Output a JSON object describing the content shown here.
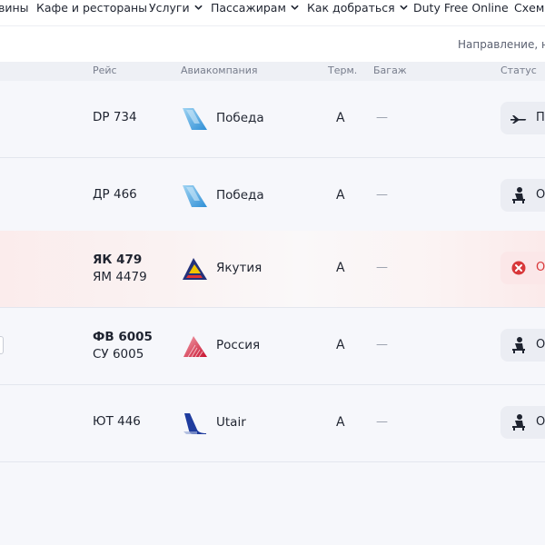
{
  "nav": {
    "items": [
      {
        "label": "вины",
        "has_dropdown": false
      },
      {
        "label": "Кафе и рестораны",
        "has_dropdown": false
      },
      {
        "label": "Услуги",
        "has_dropdown": true
      },
      {
        "label": "Пассажирам",
        "has_dropdown": true
      },
      {
        "label": "Как добраться",
        "has_dropdown": true
      },
      {
        "label": "Duty Free Online",
        "has_dropdown": false
      },
      {
        "label": "Схема",
        "has_dropdown": false
      }
    ]
  },
  "direction": {
    "label": "Направление, но"
  },
  "table": {
    "headers": {
      "flight": "Рейс",
      "airline": "Авиакомпания",
      "terminal": "Терм.",
      "baggage": "Багаж",
      "status": "Статус"
    },
    "rows": [
      {
        "flights": [
          "DP 734"
        ],
        "airline": "Победа",
        "logo": "pobeda-logo-icon",
        "terminal": "A",
        "baggage": "—",
        "status_icon": "airplane-icon",
        "status_text": "П",
        "cancelled": false
      },
      {
        "flights": [
          "ДР 466"
        ],
        "airline": "Победа",
        "logo": "pobeda-logo-icon",
        "terminal": "A",
        "baggage": "—",
        "status_icon": "waiting-passenger-icon",
        "status_text": "О",
        "cancelled": false
      },
      {
        "flights": [
          "ЯК 479",
          "ЯМ 4479"
        ],
        "airline": "Якутия",
        "logo": "yakutia-logo-icon",
        "terminal": "A",
        "baggage": "—",
        "status_icon": "cancel-x-icon",
        "status_text": "О",
        "cancelled": true
      },
      {
        "flights": [
          "ФВ 6005",
          "СУ 6005"
        ],
        "airline": "Россия",
        "logo": "rossiya-logo-icon",
        "terminal": "A",
        "baggage": "—",
        "status_icon": "waiting-passenger-icon",
        "status_text": "О",
        "cancelled": false
      },
      {
        "flights": [
          "ЮТ 446"
        ],
        "airline": "Utair",
        "logo": "utair-logo-icon",
        "terminal": "A",
        "baggage": "—",
        "status_icon": "waiting-passenger-icon",
        "status_text": "О",
        "cancelled": false
      }
    ]
  },
  "colors": {
    "text": "#1f2430",
    "header_bg": "#eef0f5",
    "row_bg": "#f6f7fb",
    "cancel_red": "#d8383a",
    "status_pill_bg": "#ebedf3"
  }
}
